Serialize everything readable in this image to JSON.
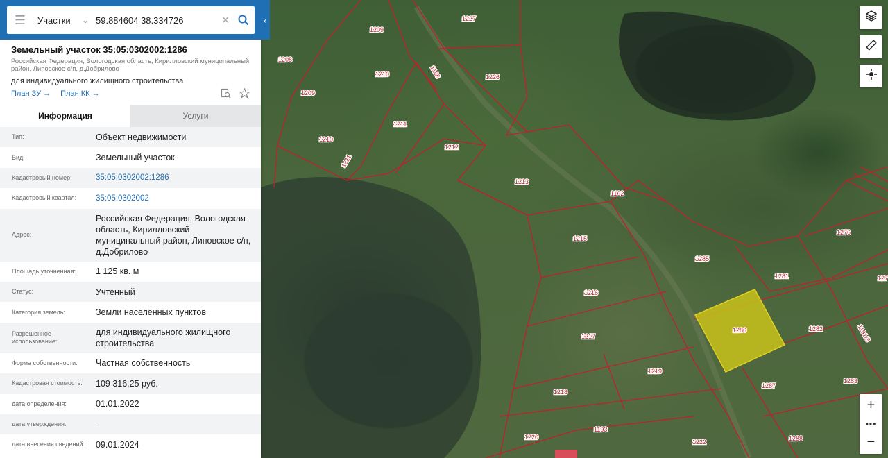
{
  "search": {
    "category": "Участки",
    "query": "59.884604 38.334726"
  },
  "parcel": {
    "title": "Земельный участок 35:05:0302002:1286",
    "address_small": "Российская Федерация, Вологодская область, Кирилловский муниципальный район, Липовское с/п, д.Добрилово",
    "purpose": "для индивидуального жилищного строительства",
    "plan_zu": "План ЗУ",
    "plan_kk": "План КК"
  },
  "tabs": {
    "info": "Информация",
    "services": "Услуги"
  },
  "rows": [
    {
      "label": "Тип:",
      "value": "Объект недвижимости"
    },
    {
      "label": "Вид:",
      "value": "Земельный участок"
    },
    {
      "label": "Кадастровый номер:",
      "value": "35:05:0302002:1286"
    },
    {
      "label": "Кадастровый квартал:",
      "value": "35:05:0302002"
    },
    {
      "label": "Адрес:",
      "value": "Российская Федерация, Вологодская область, Кирилловский муниципальный район, Липовское с/п, д.Добрилово"
    },
    {
      "label": "Площадь уточненная:",
      "value": "1 125 кв. м"
    },
    {
      "label": "Статус:",
      "value": "Учтенный"
    },
    {
      "label": "Категория земель:",
      "value": "Земли населённых пунктов"
    },
    {
      "label": "Разрешенное использование:",
      "value": "для индивидуального жилищного строительства"
    },
    {
      "label": "Форма собственности:",
      "value": "Частная собственность"
    },
    {
      "label": "Кадастровая стоимость:",
      "value": "109 316,25 руб."
    },
    {
      "label": "дата определения:",
      "value": "01.01.2022"
    },
    {
      "label": "дата утверждения:",
      "value": "-"
    },
    {
      "label": "дата внесения сведений:",
      "value": "09.01.2024"
    }
  ],
  "map": {
    "parcel_labels": [
      "1227",
      "1209",
      "1208",
      "1186",
      "1226",
      "1210",
      "1209",
      "1211",
      "1210",
      "1212",
      "1211",
      "1213",
      "1192",
      "1215",
      "1276",
      "1285",
      "1281",
      "127",
      "1216",
      "1286",
      "1282",
      "1191/3",
      "1217",
      "1219",
      "1287",
      "1283",
      "1218",
      "1193",
      "1220",
      "1222",
      "1288"
    ],
    "selected_parcel": "1286",
    "colors": {
      "boundary": "#c0202a",
      "selected_fill": "#c9c21a",
      "accent": "#1f6fb5"
    }
  },
  "controls": {
    "layers_icon": "layers-icon",
    "ruler_icon": "ruler-icon",
    "locate_icon": "crosshair-icon",
    "zoom_in": "+",
    "zoom_more": "•••",
    "zoom_out": "−"
  }
}
